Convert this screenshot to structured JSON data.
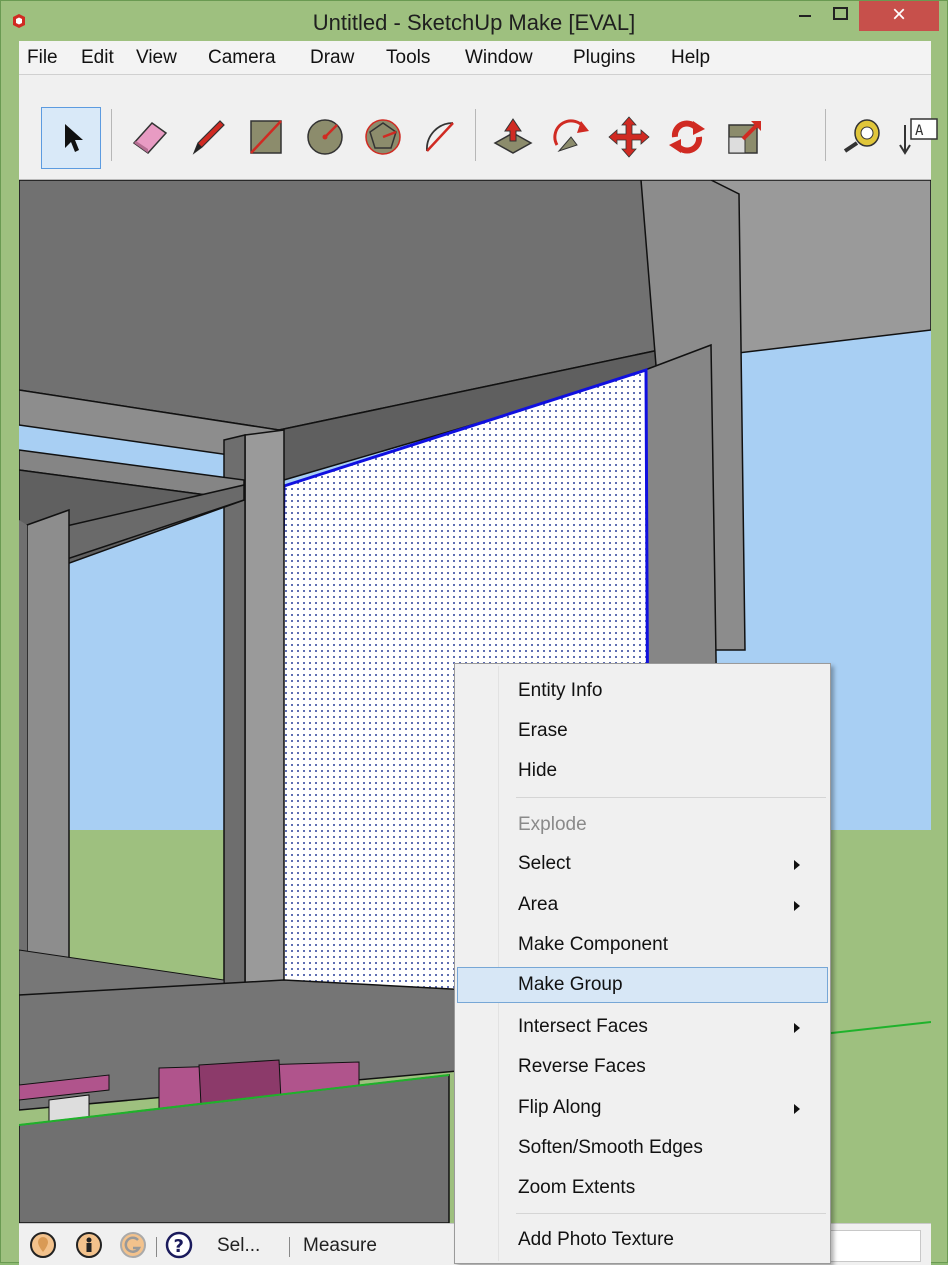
{
  "window": {
    "title": "Untitled - SketchUp Make [EVAL]",
    "close_glyph": "×"
  },
  "menubar": {
    "items": [
      "File",
      "Edit",
      "View",
      "Camera",
      "Draw",
      "Tools",
      "Window",
      "Plugins",
      "Help"
    ]
  },
  "toolbar": {
    "tools": [
      {
        "icon": "select-arrow-icon",
        "active": true
      },
      {
        "icon": "eraser-icon"
      },
      {
        "icon": "pencil-icon"
      },
      {
        "icon": "rectangle-icon"
      },
      {
        "icon": "circle-icon"
      },
      {
        "icon": "polygon-icon"
      },
      {
        "icon": "arc-icon"
      },
      {
        "icon": "push-pull-icon"
      },
      {
        "icon": "follow-me-icon"
      },
      {
        "icon": "move-icon"
      },
      {
        "icon": "rotate-icon"
      },
      {
        "icon": "scale-icon"
      },
      {
        "icon": "tape-measure-icon"
      },
      {
        "icon": "text-icon"
      }
    ]
  },
  "statusbar": {
    "icons": [
      "geo-location-icon",
      "credits-icon",
      "google-sign-in-icon",
      "help-icon"
    ],
    "status_text": "Sel...",
    "measurements_label": "Measure",
    "measurements_value": ""
  },
  "context_menu": {
    "items": [
      {
        "label": "Entity Info"
      },
      {
        "label": "Erase"
      },
      {
        "label": "Hide"
      },
      {
        "label": "Explode",
        "disabled": true
      },
      {
        "label": "Select",
        "submenu": true
      },
      {
        "label": "Area",
        "submenu": true
      },
      {
        "label": "Make Component"
      },
      {
        "label": "Make Group",
        "highlighted": true
      },
      {
        "label": "Intersect Faces",
        "submenu": true
      },
      {
        "label": "Reverse Faces"
      },
      {
        "label": "Flip Along",
        "submenu": true
      },
      {
        "label": "Soften/Smooth Edges"
      },
      {
        "label": "Zoom Extents"
      },
      {
        "label": "Add Photo Texture"
      }
    ]
  },
  "colors": {
    "accent_highlight": "#d7e7f6",
    "selection_edge": "#1010e0",
    "sky": "#a8cff3",
    "ground": "#9ec07f",
    "close_button": "#c7504b"
  }
}
